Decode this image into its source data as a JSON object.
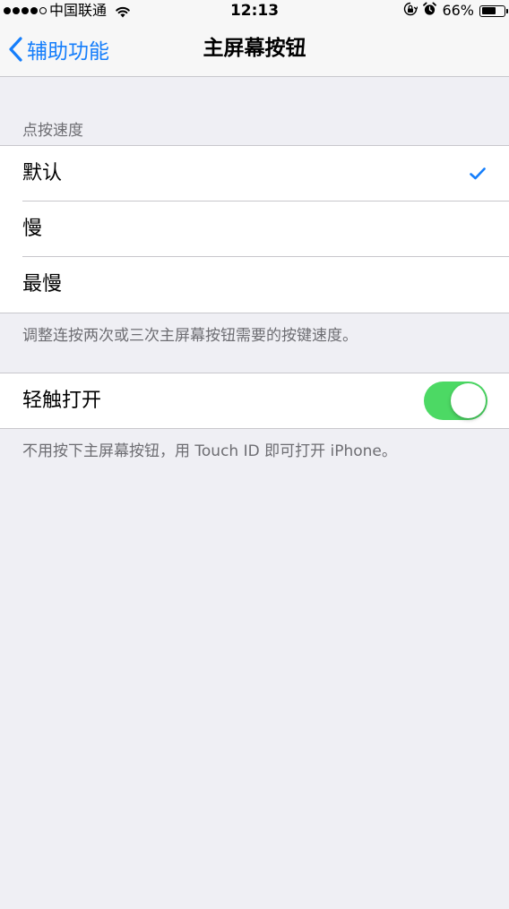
{
  "status_bar": {
    "carrier": "中国联通",
    "time": "12:13",
    "battery_percent": "66%",
    "battery_level": 0.66,
    "signal_bars_filled": 4,
    "signal_bars_total": 5,
    "icons": [
      "wifi-icon",
      "orientation-lock-icon",
      "alarm-icon",
      "battery-icon"
    ]
  },
  "nav": {
    "back_label": "辅助功能",
    "title": "主屏幕按钮"
  },
  "click_speed": {
    "header": "点按速度",
    "options": [
      {
        "label": "默认",
        "selected": true
      },
      {
        "label": "慢",
        "selected": false
      },
      {
        "label": "最慢",
        "selected": false
      }
    ],
    "footer": "调整连按两次或三次主屏幕按钮需要的按键速度。"
  },
  "rest_finger": {
    "label": "轻触打开",
    "enabled": true,
    "footer": "不用按下主屏幕按钮，用 Touch ID 即可打开 iPhone。"
  },
  "colors": {
    "accent": "#157efb",
    "toggle_on": "#4cd964",
    "background": "#efeff4",
    "secondary_text": "#6d6d72"
  }
}
